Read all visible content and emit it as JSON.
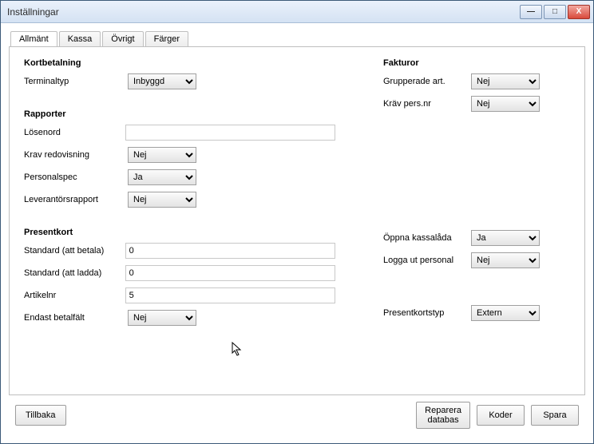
{
  "window": {
    "title": "Inställningar",
    "min_icon": "—",
    "max_icon": "□",
    "close_icon": "X"
  },
  "tabs": [
    {
      "label": "Allmänt"
    },
    {
      "label": "Kassa"
    },
    {
      "label": "Övrigt"
    },
    {
      "label": "Färger"
    }
  ],
  "sections": {
    "kortbetalning": {
      "title": "Kortbetalning",
      "terminaltyp_label": "Terminaltyp",
      "terminaltyp_value": "Inbyggd"
    },
    "fakturor": {
      "title": "Fakturor",
      "grupperade_label": "Grupperade art.",
      "grupperade_value": "Nej",
      "krav_pers_label": "Kräv pers.nr",
      "krav_pers_value": "Nej"
    },
    "rapporter": {
      "title": "Rapporter",
      "losenord_label": "Lösenord",
      "losenord_value": "",
      "krav_redov_label": "Krav redovisning",
      "krav_redov_value": "Nej",
      "personalspec_label": "Personalspec",
      "personalspec_value": "Ja",
      "lev_label": "Leverantörsrapport",
      "lev_value": "Nej"
    },
    "presentkort": {
      "title": "Presentkort",
      "std_betala_label": "Standard (att betala)",
      "std_betala_value": "0",
      "std_ladda_label": "Standard (att ladda)",
      "std_ladda_value": "0",
      "artikelnr_label": "Artikelnr",
      "artikelnr_value": "5",
      "endast_label": "Endast betalfält",
      "endast_value": "Nej"
    },
    "right_misc": {
      "oppna_label": "Öppna kassalåda",
      "oppna_value": "Ja",
      "logga_label": "Logga ut personal",
      "logga_value": "Nej",
      "pktyp_label": "Presentkortstyp",
      "pktyp_value": "Extern"
    }
  },
  "buttons": {
    "tillbaka": "Tillbaka",
    "reparera_line1": "Reparera",
    "reparera_line2": "databas",
    "koder": "Koder",
    "spara": "Spara"
  }
}
